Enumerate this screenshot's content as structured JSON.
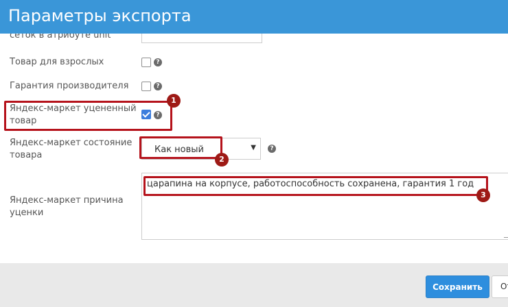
{
  "dialog": {
    "title": "Параметры экспорта"
  },
  "fields": {
    "cut_label": "сеток в атрибуте unit",
    "adult_label": "Товар для взрослых",
    "warranty_label": "Гарантия производителя",
    "discounted_label_line1": "Яндекс-маркет уцененный",
    "discounted_label_line2": "товар",
    "discounted_checked": true,
    "condition_label_line1": "Яндекс-маркет состояние",
    "condition_label_line2": "товара",
    "condition_value": "Как новый",
    "reason_label_line1": "Яндекс-маркет причина",
    "reason_label_line2": "уценки",
    "reason_value": "царапина на корпусе, работоспособность сохранена, гарантия 1 год"
  },
  "help_icon_glyph": "?",
  "markers": [
    "1",
    "2",
    "3"
  ],
  "footer": {
    "save_label": "Сохранить",
    "cancel_label": "Отмена"
  },
  "colors": {
    "header": "#3a96d8",
    "highlight": "#b5121b",
    "marker": "#9e1a16",
    "save_button": "#2e8ede",
    "checkbox_checked": "#3b7ddd"
  },
  "icons": {
    "help": "question-circle-icon",
    "select_arrow": "caret-down-icon"
  }
}
